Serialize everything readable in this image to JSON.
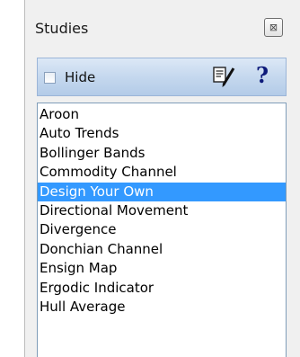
{
  "panel": {
    "title": "Studies",
    "close_label": "⊠"
  },
  "toolbar": {
    "hide_label": "Hide",
    "hide_checked": false,
    "edit_icon": "edit-pencil-icon",
    "help_label": "?"
  },
  "studies": {
    "selected": "Design Your Own",
    "items": [
      "Aroon",
      "Auto Trends",
      "Bollinger Bands",
      "Commodity Channel",
      "Design Your Own",
      "Directional Movement",
      "Divergence",
      "Donchian Channel",
      "Ensign Map",
      "Ergodic Indicator",
      "Hull Average"
    ]
  },
  "colors": {
    "selection": "#3399ff",
    "toolbar": "#c5d8ee",
    "help_icon": "#0d1a7a"
  }
}
